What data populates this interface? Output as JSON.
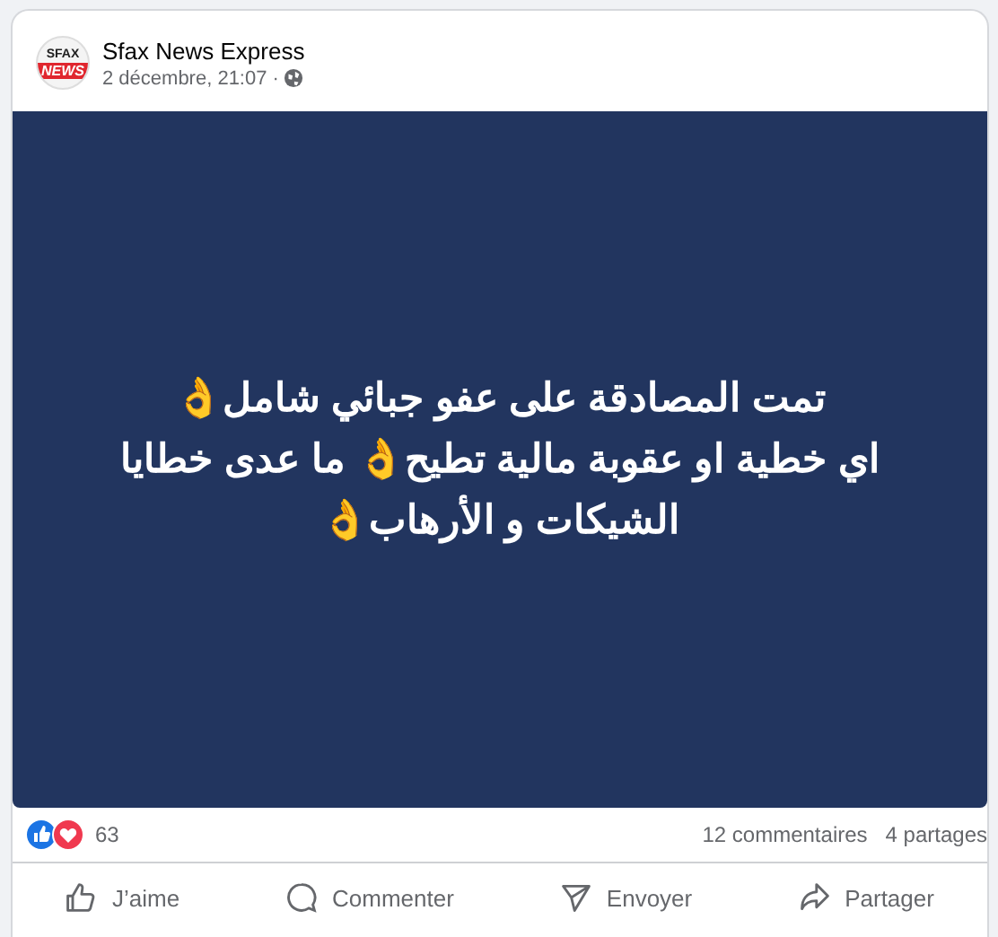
{
  "post": {
    "author": "Sfax News Express",
    "avatar": {
      "top": "SFAX",
      "bottom": "NEWS"
    },
    "time": "2 décembre, 21:07",
    "separator": "·",
    "text_lines": [
      "تمت المصادقة على عفو جبائي شامل👌",
      "اي خطية او عقوبة مالية تطيح👌 ما عدى خطايا",
      "الشيكات و الأرهاب👌"
    ],
    "reaction_count": "63",
    "comments": "12 commentaires",
    "shares": "4 partages",
    "actions": [
      {
        "label": "J’aime",
        "kind": "like"
      },
      {
        "label": "Commenter",
        "kind": "comment"
      },
      {
        "label": "Envoyer",
        "kind": "send"
      },
      {
        "label": "Partager",
        "kind": "share"
      }
    ]
  }
}
